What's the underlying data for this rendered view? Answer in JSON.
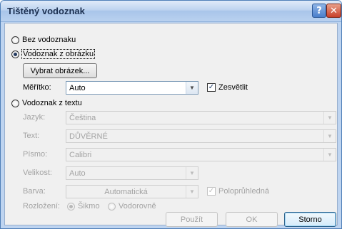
{
  "window": {
    "title": "Tištěný vodoznak",
    "help_glyph": "?",
    "close_glyph": "✕"
  },
  "options": {
    "none": "Bez vodoznaku",
    "picture": "Vodoznak z obrázku",
    "text": "Vodoznak z textu"
  },
  "picture": {
    "select_button": "Vybrat obrázek...",
    "scale_label": "Měřítko:",
    "scale_value": "Auto",
    "washout_label": "Zesvětlit",
    "washout_checked": true
  },
  "text_section": {
    "language_label": "Jazyk:",
    "language_value": "Čeština",
    "text_label": "Text:",
    "text_value": "DŮVĚRNÉ",
    "font_label": "Písmo:",
    "font_value": "Calibri",
    "size_label": "Velikost:",
    "size_value": "Auto",
    "color_label": "Barva:",
    "color_value": "Automatická",
    "semitransparent_label": "Poloprůhledná",
    "layout_label": "Rozložení:",
    "layout_diagonal": "Šikmo",
    "layout_horizontal": "Vodorovně"
  },
  "footer": {
    "apply": "Použít",
    "ok": "OK",
    "cancel": "Storno"
  },
  "icons": {
    "dropdown": "chevron-down-icon",
    "check": "check-icon"
  }
}
